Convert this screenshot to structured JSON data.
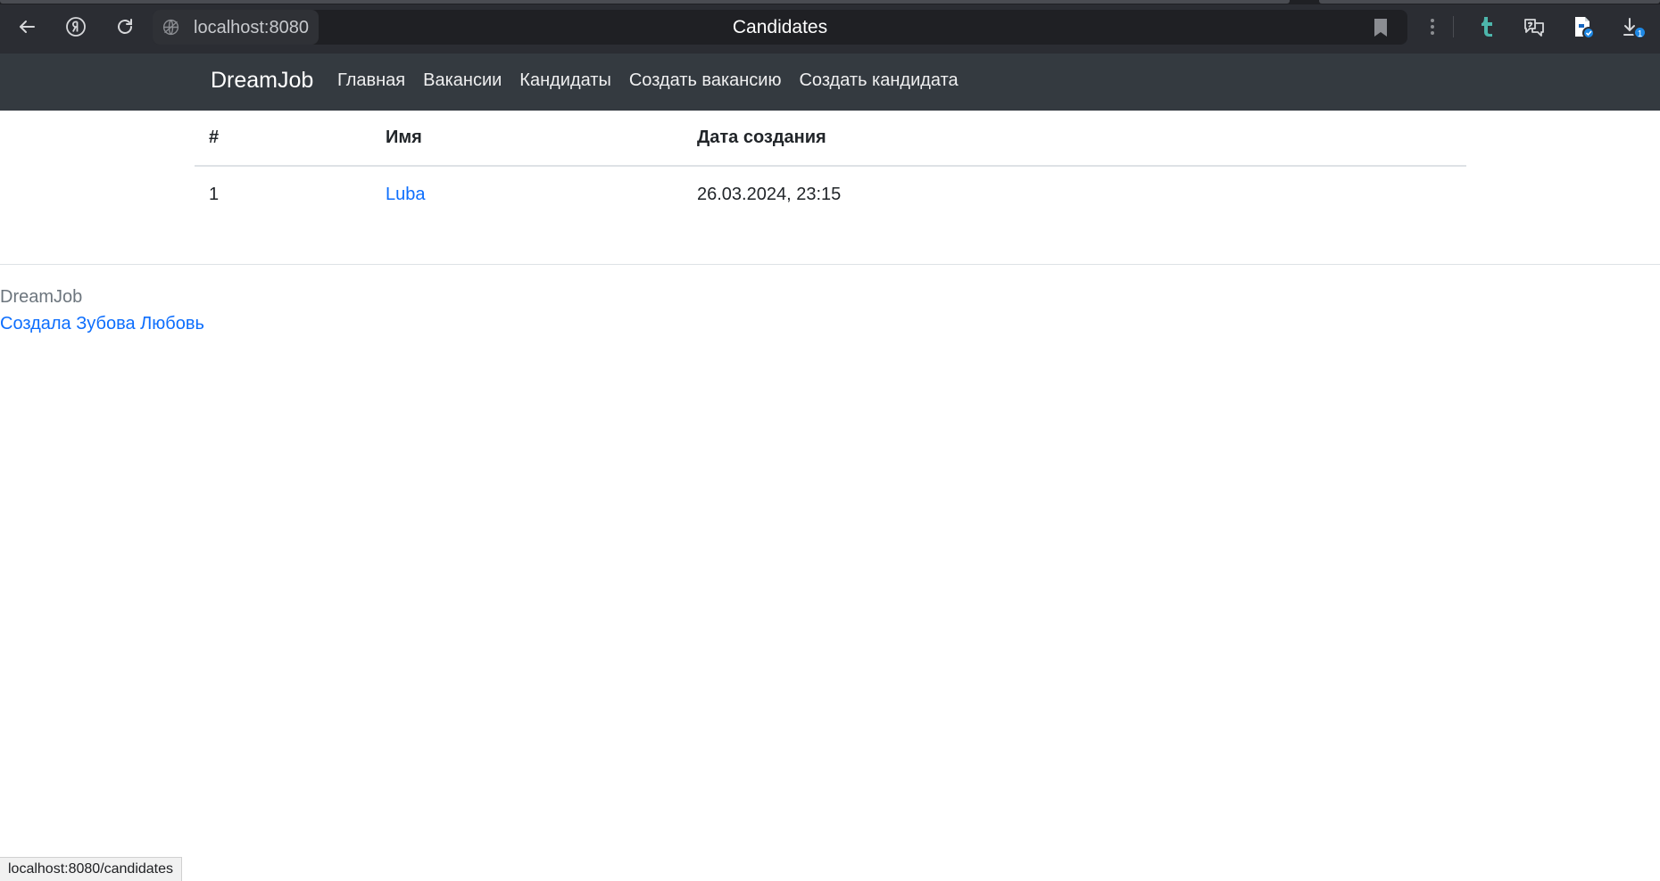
{
  "browser": {
    "address": "localhost:8080",
    "tab_title": "Candidates",
    "icons": {
      "back": "arrow-left-icon",
      "yandex": "yandex-logo-icon",
      "reload": "reload-icon",
      "site_info": "globe-icon",
      "bookmark": "bookmark-icon",
      "menu": "kebab-menu-icon",
      "tumblr": "tumblr-icon",
      "translate": "translate-icon",
      "extension": "extension-icon",
      "downloads": "download-icon"
    },
    "downloads_badge": "1",
    "status_url": "localhost:8080/candidates"
  },
  "navbar": {
    "brand": "DreamJob",
    "links": [
      {
        "label": "Главная"
      },
      {
        "label": "Вакансии"
      },
      {
        "label": "Кандидаты"
      },
      {
        "label": "Создать вакансию"
      },
      {
        "label": "Создать кандидата"
      }
    ]
  },
  "table": {
    "headers": [
      "#",
      "Имя",
      "Дата создания"
    ],
    "rows": [
      {
        "id": "1",
        "name": "Luba",
        "created": "26.03.2024, 23:15"
      }
    ]
  },
  "footer": {
    "brand": "DreamJob",
    "author": "Создала Зубова Любовь"
  },
  "colors": {
    "navbar_bg": "#343a40",
    "link": "#0d6efd",
    "chrome_bg": "#2b2d33"
  }
}
